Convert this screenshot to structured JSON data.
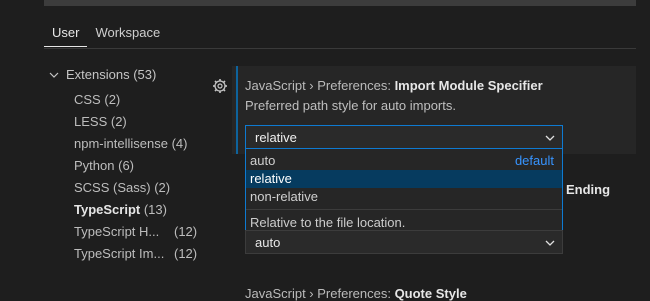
{
  "tabs": [
    {
      "label": "User",
      "active": true
    },
    {
      "label": "Workspace",
      "active": false
    }
  ],
  "tree": {
    "group_label": "Extensions (53)",
    "items": [
      {
        "label": "CSS",
        "count": "(2)"
      },
      {
        "label": "LESS",
        "count": "(2)"
      },
      {
        "label": "npm-intellisense",
        "count": "(4)"
      },
      {
        "label": "Python",
        "count": "(6)"
      },
      {
        "label": "SCSS (Sass)",
        "count": "(2)"
      },
      {
        "label": "TypeScript",
        "count": "(13)",
        "bold": true
      },
      {
        "label": "TypeScript H...",
        "count": "(12)"
      },
      {
        "label": "TypeScript Im...",
        "count": "(12)"
      }
    ]
  },
  "setting": {
    "title_prefix": "JavaScript › Preferences: ",
    "title_name": "Import Module Specifier",
    "description": "Preferred path style for auto imports.",
    "value": "relative",
    "options": [
      {
        "label": "auto",
        "default_tag": "default"
      },
      {
        "label": "relative",
        "selected": true
      },
      {
        "label": "non-relative"
      }
    ],
    "option_description": "Relative to the file location."
  },
  "partial_setting": {
    "title_suffix": "Ending",
    "value": "auto"
  },
  "next_setting": {
    "title_prefix": "JavaScript › Preferences: ",
    "title_name": "Quote Style"
  },
  "icons": {
    "gear": "gear-icon",
    "chevron": "chevron-down-icon"
  },
  "colors": {
    "accent": "#0e7ad1",
    "selected_bg": "#063b5f",
    "default_tag": "#3794ff",
    "background": "#1e1e1e"
  }
}
